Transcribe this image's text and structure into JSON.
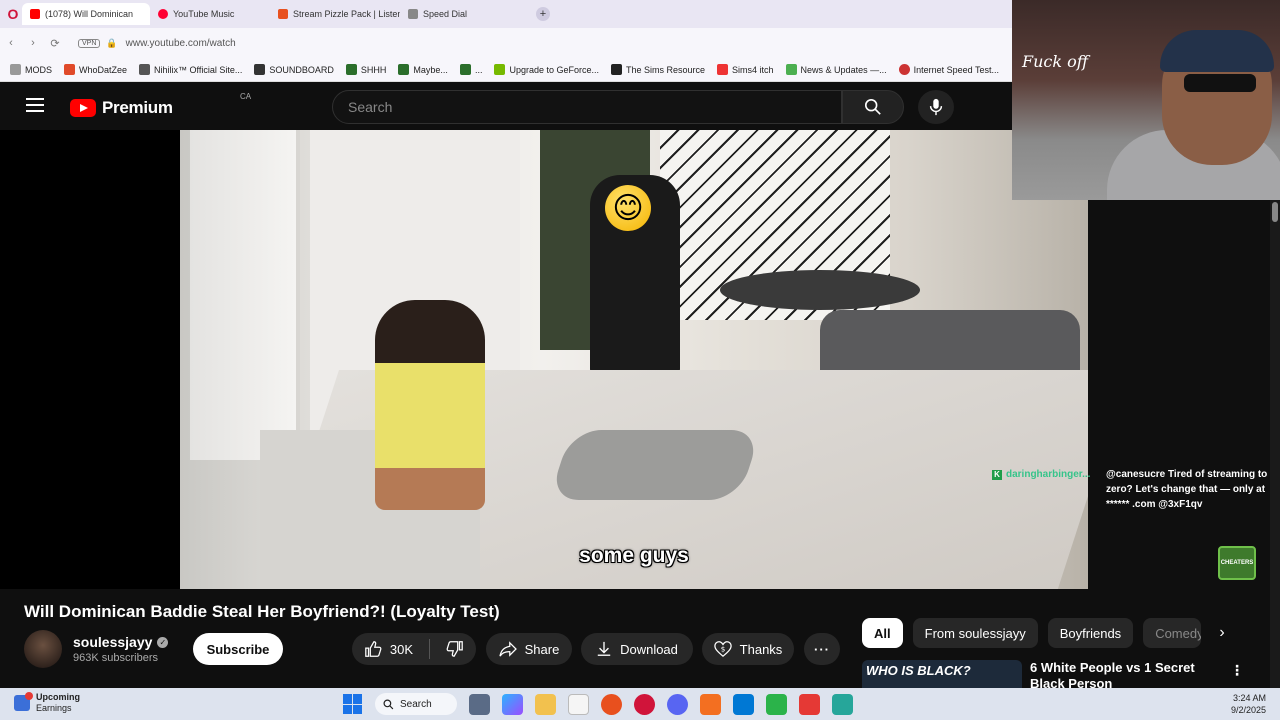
{
  "browser": {
    "tabs": [
      {
        "label": "(1078) Will Dominican",
        "active": true
      },
      {
        "label": "YouTube Music"
      },
      {
        "label": "Stream Pizzle Pack | Listen"
      },
      {
        "label": "Speed Dial"
      }
    ],
    "new_tab_glyph": "+",
    "vpn_label": "VPN",
    "url": "www.youtube.com/watch",
    "bookmarks": [
      "MODS",
      "WhoDatZee",
      "Nihilix™ Official Site...",
      "SOUNDBOARD",
      "SHHH",
      "Maybe...",
      "...",
      "Upgrade to GeForce...",
      "The Sims Resource",
      "Sims4 itch",
      "News & Updates —...",
      "Internet Speed Test..."
    ]
  },
  "youtube": {
    "brand": "Premium",
    "region": "CA",
    "search_placeholder": "Search",
    "subtitle": "some guys",
    "video_title": "Will Dominican Baddie Steal Her Boyfriend?! (Loyalty Test)",
    "channel_name": "soulessjayy",
    "verified_glyph": "✓",
    "subscribers": "963K subscribers",
    "subscribe_label": "Subscribe",
    "likes": "30K",
    "share_label": "Share",
    "download_label": "Download",
    "thanks_label": "Thanks",
    "more_glyph": "···",
    "chips": [
      "All",
      "From soulessjayy",
      "Boyfriends",
      "Comedy"
    ],
    "rec_thumb_text": "WHO IS BLACK?",
    "rec_title": "6 White People vs 1 Secret Black Person",
    "rec_menu_glyph": "⋮"
  },
  "stream": {
    "chat_user": "daringharbinger...",
    "chat_message": "@canesucre Tired of streaming to zero? Let's change that — only at ****** .com @3xF1qv",
    "chat_badge": "K",
    "webcam_sign": "Fuck off",
    "cheaters_label": "CHEATERS"
  },
  "taskbar": {
    "widget_title": "Upcoming",
    "widget_sub": "Earnings",
    "search_label": "Search",
    "time": "3:24 AM",
    "date": "9/2/2025"
  },
  "colors": {
    "yt_bg": "#0f0f0f",
    "yt_red": "#ff0000",
    "chip_bg": "#272727",
    "chat_user": "#36c48a"
  }
}
